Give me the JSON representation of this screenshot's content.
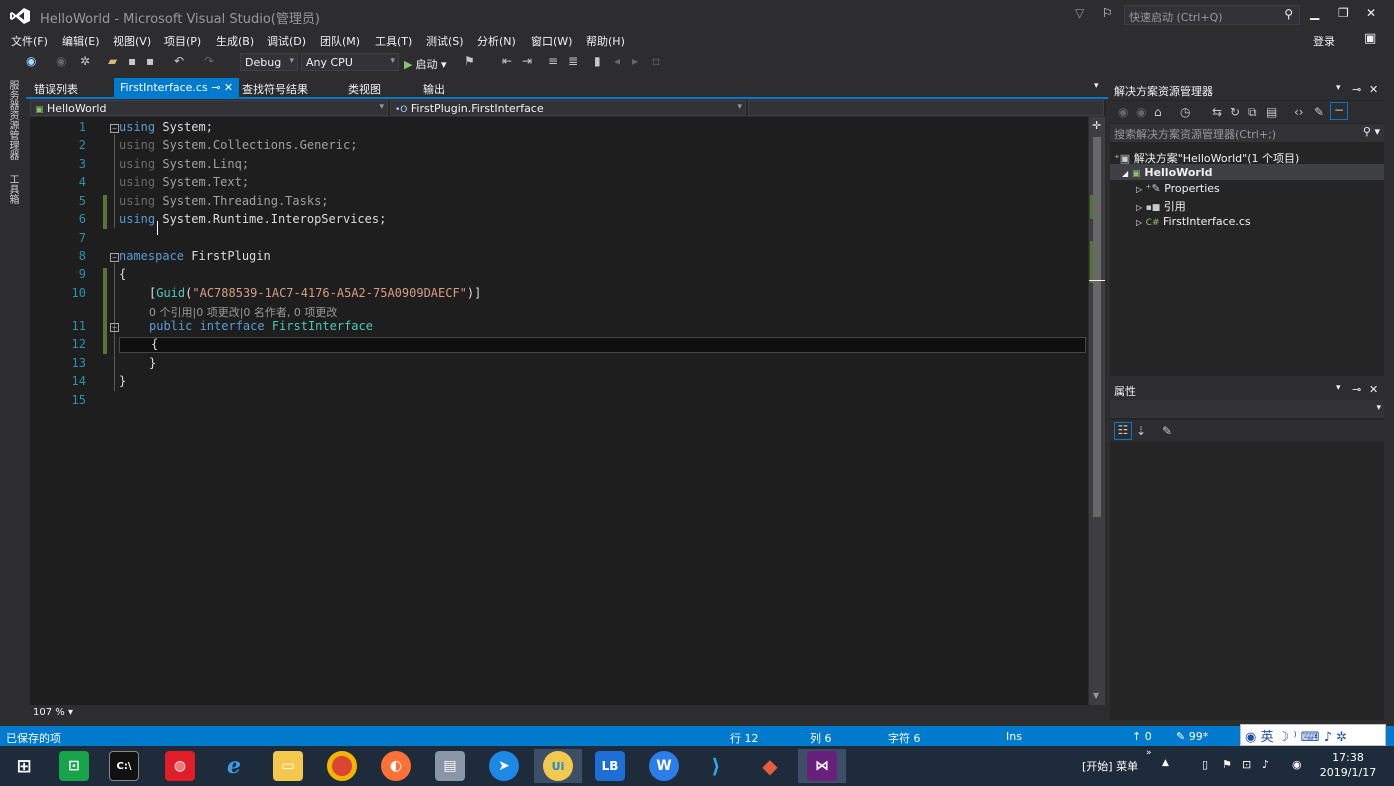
{
  "window": {
    "title": "HelloWorld - Microsoft Visual Studio(管理员)",
    "quick_launch_placeholder": "快速启动 (Ctrl+Q)",
    "signin": "登录"
  },
  "menu": [
    "文件(F)",
    "编辑(E)",
    "视图(V)",
    "项目(P)",
    "生成(B)",
    "调试(D)",
    "团队(M)",
    "工具(T)",
    "测试(S)",
    "分析(N)",
    "窗口(W)",
    "帮助(H)"
  ],
  "toolbar": {
    "config": "Debug",
    "platform": "Any CPU",
    "start_label": "启动"
  },
  "left_strip": {
    "server_explorer": "服务器资源管理器",
    "toolbox": "工具箱"
  },
  "tabs": {
    "error_list": "错误列表",
    "active_file": "FirstInterface.cs",
    "find_symbol": "查找符号结果",
    "class_view": "类视图",
    "output": "输出"
  },
  "navbar": {
    "project": "HelloWorld",
    "member": "FirstPlugin.FirstInterface"
  },
  "editor": {
    "line_numbers": [
      "1",
      "2",
      "3",
      "4",
      "5",
      "6",
      "7",
      "8",
      "9",
      "10",
      "11",
      "12",
      "13",
      "14",
      "15"
    ],
    "lines": {
      "l1_kw": "using",
      "l1_rest": " System;",
      "l2_kw": "using",
      "l2_rest": " System.Collections.Generic;",
      "l3_kw": "using",
      "l3_rest": " System.Linq;",
      "l4_kw": "using",
      "l4_rest": " System.Text;",
      "l5_kw": "using",
      "l5_rest": " System.Threading.Tasks;",
      "l6_kw": "using",
      "l6_rest": " System.Runtime.InteropServices;",
      "l8_kw": "namespace",
      "l8_rest": " FirstPlugin",
      "l9": "{",
      "l10_open": "[",
      "l10_attr": "Guid",
      "l10_paren": "(",
      "l10_str": "\"AC788539-1AC7-4176-A5A2-75A0909DAECF\"",
      "l10_close": ")]",
      "codelens": "0 个引用|0 项更改|0 名作者, 0 项更改",
      "l11_kw1": "public",
      "l11_kw2": " interface",
      "l11_type": " FirstInterface",
      "l12": "{",
      "l13": "}",
      "l14": "}"
    },
    "zoom": "107 %"
  },
  "solution_explorer": {
    "title": "解决方案资源管理器",
    "search_placeholder": "搜索解决方案资源管理器(Ctrl+;)",
    "solution": "解决方案\"HelloWorld\"(1 个项目)",
    "project": "HelloWorld",
    "properties": "Properties",
    "references": "引用",
    "file": "FirstInterface.cs"
  },
  "properties": {
    "title": "属性"
  },
  "status": {
    "saved": "已保存的项",
    "line": "行 12",
    "col": "列 6",
    "char": "字符 6",
    "ins": "Ins",
    "up": "0",
    "edits": "99*"
  },
  "ime": {
    "lang": "英"
  },
  "taskbar": {
    "start_menu": "[开始] 菜单",
    "time": "17:38",
    "date": "2019/1/17"
  },
  "colors": {
    "accent": "#007acc",
    "keyword": "#569cd6",
    "type": "#4ec9b0",
    "string": "#d69d85"
  }
}
